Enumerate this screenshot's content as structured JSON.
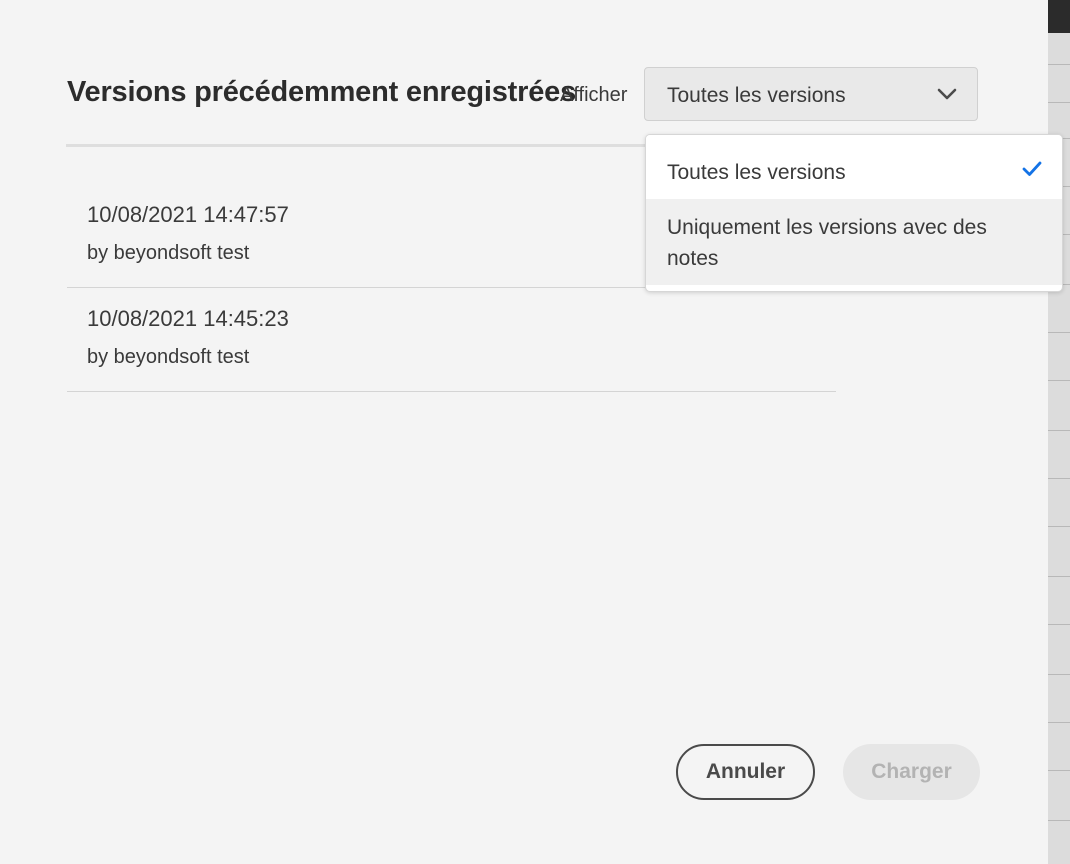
{
  "dialog": {
    "title": "Versions précédemment enregistrées",
    "filter": {
      "label": "Afficher",
      "selected": "Toutes les versions",
      "chevron_icon": "chevron-down-icon",
      "options": [
        {
          "label": "Toutes les versions",
          "checked": true,
          "check_icon": "checkmark-icon",
          "check_color": "#1473e6"
        },
        {
          "label": "Uniquement les versions avec des notes",
          "checked": false
        }
      ]
    },
    "versions": [
      {
        "timestamp": "10/08/2021 14:47:57",
        "author": "by beyondsoft test"
      },
      {
        "timestamp": "10/08/2021 14:45:23",
        "author": "by beyondsoft test"
      }
    ],
    "buttons": {
      "cancel": "Annuler",
      "load": "Charger"
    }
  }
}
